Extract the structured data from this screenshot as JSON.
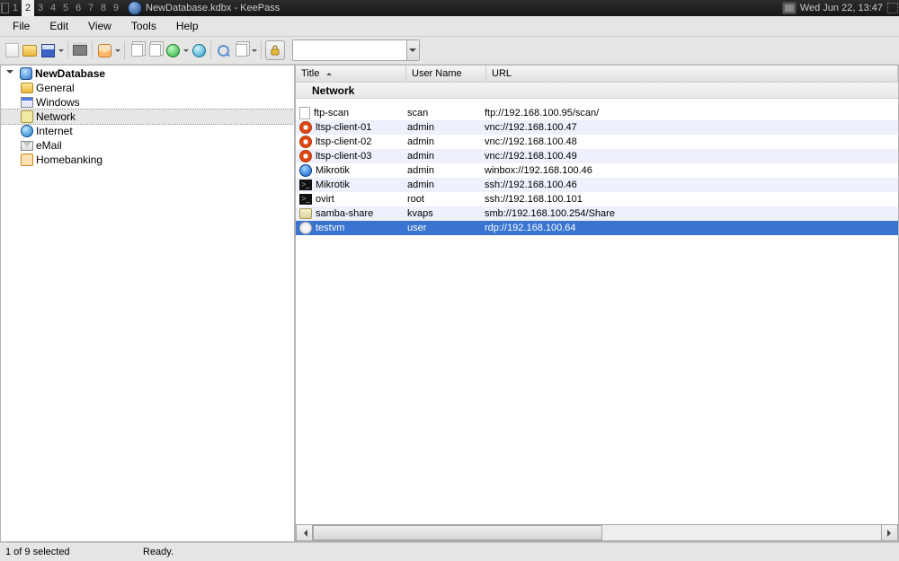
{
  "sysbar": {
    "workspaces": [
      "1",
      "2",
      "3",
      "4",
      "5",
      "6",
      "7",
      "8",
      "9"
    ],
    "active_workspace": 1,
    "task_title": "NewDatabase.kdbx - KeePass",
    "clock": "Wed Jun 22, 13:47"
  },
  "menubar": [
    "File",
    "Edit",
    "View",
    "Tools",
    "Help"
  ],
  "toolbar": {
    "buttons": [
      "new",
      "open",
      "save",
      "sep",
      "print",
      "sep",
      "add-entry",
      "sep",
      "copy-user",
      "copy-password",
      "open-url",
      "autotype",
      "sep",
      "find",
      "show-entries",
      "sep",
      "lock"
    ],
    "search_value": ""
  },
  "tree": {
    "root": "NewDatabase",
    "items": [
      {
        "icon": "folder",
        "label": "General",
        "selected": false
      },
      {
        "icon": "win",
        "label": "Windows",
        "selected": false
      },
      {
        "icon": "net",
        "label": "Network",
        "selected": true
      },
      {
        "icon": "globe",
        "label": "Internet",
        "selected": false
      },
      {
        "icon": "mail",
        "label": "eMail",
        "selected": false
      },
      {
        "icon": "bank",
        "label": "Homebanking",
        "selected": false
      }
    ]
  },
  "list": {
    "columns": {
      "title": "Title",
      "user": "User Name",
      "url": "URL"
    },
    "sort_column": "title",
    "group": "Network",
    "entries": [
      {
        "icon": "page",
        "title": "ftp-scan",
        "user": "scan",
        "url": "ftp://192.168.100.95/scan/",
        "selected": false
      },
      {
        "icon": "ubuntu",
        "title": "ltsp-client-01",
        "user": "admin",
        "url": "vnc://192.168.100.47",
        "selected": false
      },
      {
        "icon": "ubuntu",
        "title": "ltsp-client-02",
        "user": "admin",
        "url": "vnc://192.168.100.48",
        "selected": false
      },
      {
        "icon": "ubuntu",
        "title": "ltsp-client-03",
        "user": "admin",
        "url": "vnc://192.168.100.49",
        "selected": false
      },
      {
        "icon": "mikrotik",
        "title": "Mikrotik",
        "user": "admin",
        "url": "winbox://192.168.100.46",
        "selected": false
      },
      {
        "icon": "term",
        "title": "Mikrotik",
        "user": "admin",
        "url": "ssh://192.168.100.46",
        "selected": false
      },
      {
        "icon": "term",
        "title": "ovirt",
        "user": "root",
        "url": "ssh://192.168.100.101",
        "selected": false
      },
      {
        "icon": "share",
        "title": "samba-share",
        "user": "kvaps",
        "url": "smb://192.168.100.254/Share",
        "selected": false
      },
      {
        "icon": "winlogo",
        "title": "testvm",
        "user": "user",
        "url": "rdp://192.168.100.64",
        "selected": true
      }
    ]
  },
  "statusbar": {
    "selection": "1 of 9 selected",
    "state": "Ready."
  }
}
